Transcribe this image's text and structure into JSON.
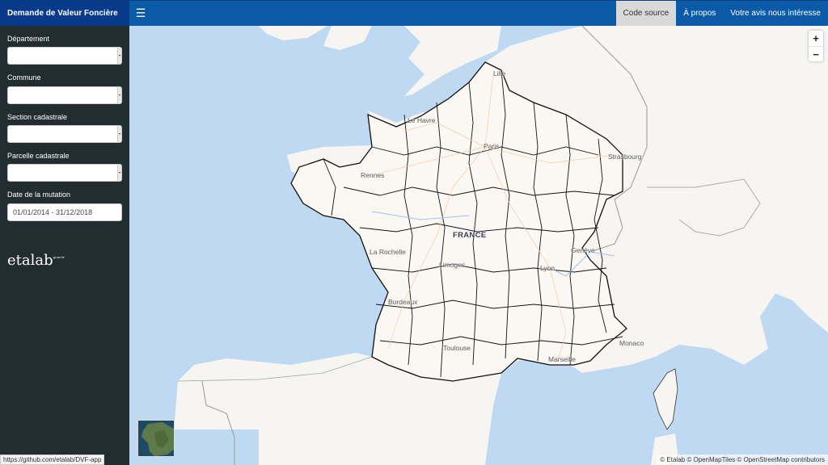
{
  "app": {
    "title": "Demande de Valeur Foncière",
    "menu_icon": "hamburger-icon"
  },
  "nav": {
    "links": [
      {
        "label": "Code source",
        "active": true
      },
      {
        "label": "À propos",
        "active": false
      },
      {
        "label": "Votre avis nous intéresse",
        "active": false
      }
    ]
  },
  "sidebar": {
    "fields": [
      {
        "label": "Département",
        "type": "select",
        "value": ""
      },
      {
        "label": "Commune",
        "type": "select",
        "value": ""
      },
      {
        "label": "Section cadastrale",
        "type": "select",
        "value": ""
      },
      {
        "label": "Parcelle cadastrale",
        "type": "select",
        "value": ""
      },
      {
        "label": "Date de la mutation",
        "type": "daterange",
        "value": "01/01/2014 - 31/12/2018"
      }
    ],
    "logo": {
      "text": "etalab",
      "sup": "gouv.fr"
    }
  },
  "map": {
    "zoom_in": "+",
    "zoom_out": "−",
    "country_label": "FRANCE",
    "cities": [
      "Lille",
      "Le Havre",
      "Paris",
      "Strasbourg",
      "Rennes",
      "La Rochelle",
      "Limoges",
      "Lyon",
      "Genève",
      "Bordeaux",
      "Toulouse",
      "Marseille",
      "Monaco"
    ],
    "attribution": "© Etalab © OpenMapTiles © OpenStreetMap contributors",
    "colors": {
      "water": "#bfd9f2",
      "land": "#f7f5f2",
      "boundary": "#111111",
      "road": "#f4c9a8"
    }
  },
  "status_bar": {
    "url": "https://github.com/etalab/DVF-app"
  }
}
